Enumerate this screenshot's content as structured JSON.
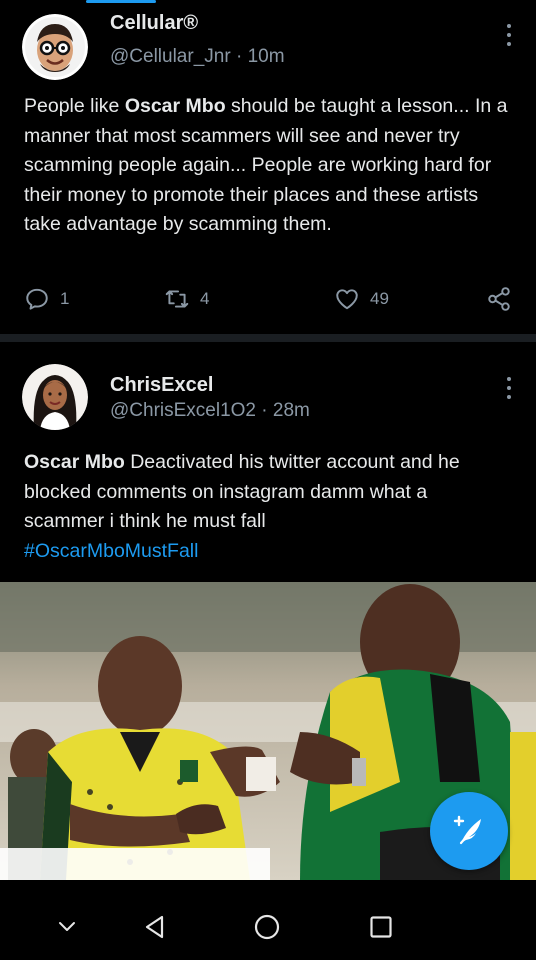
{
  "tweets": [
    {
      "display_name": "Cellular®",
      "handle": "@Cellular_Jnr",
      "time": "10m",
      "text_segments": [
        {
          "t": "People like "
        },
        {
          "t": "Oscar Mbo",
          "bold": true
        },
        {
          "t": " should be taught a lesson... In a manner that most scammers will see and never try scamming people again... People are working hard for their money to promote their places and these artists take advantage by scamming them."
        }
      ],
      "replies": "1",
      "retweets": "4",
      "likes": "49"
    },
    {
      "display_name": "ChrisExcel",
      "handle": "@ChrisExcel1O2",
      "time": "28m",
      "text_bold": "Oscar Mbo",
      "text_rest": " Deactivated his twitter account and he blocked comments on instagram damm what a scammer i think he must fall",
      "hashtag": "#OscarMboMustFall"
    }
  ],
  "separator": "·",
  "colors": {
    "accent": "#1d9bf0",
    "background": "#000000",
    "secondary_text": "#8b98a5"
  },
  "icons": {
    "reply": "reply-icon",
    "retweet": "retweet-icon",
    "like": "heart-icon",
    "share": "share-icon",
    "compose": "compose-tweet-icon"
  }
}
